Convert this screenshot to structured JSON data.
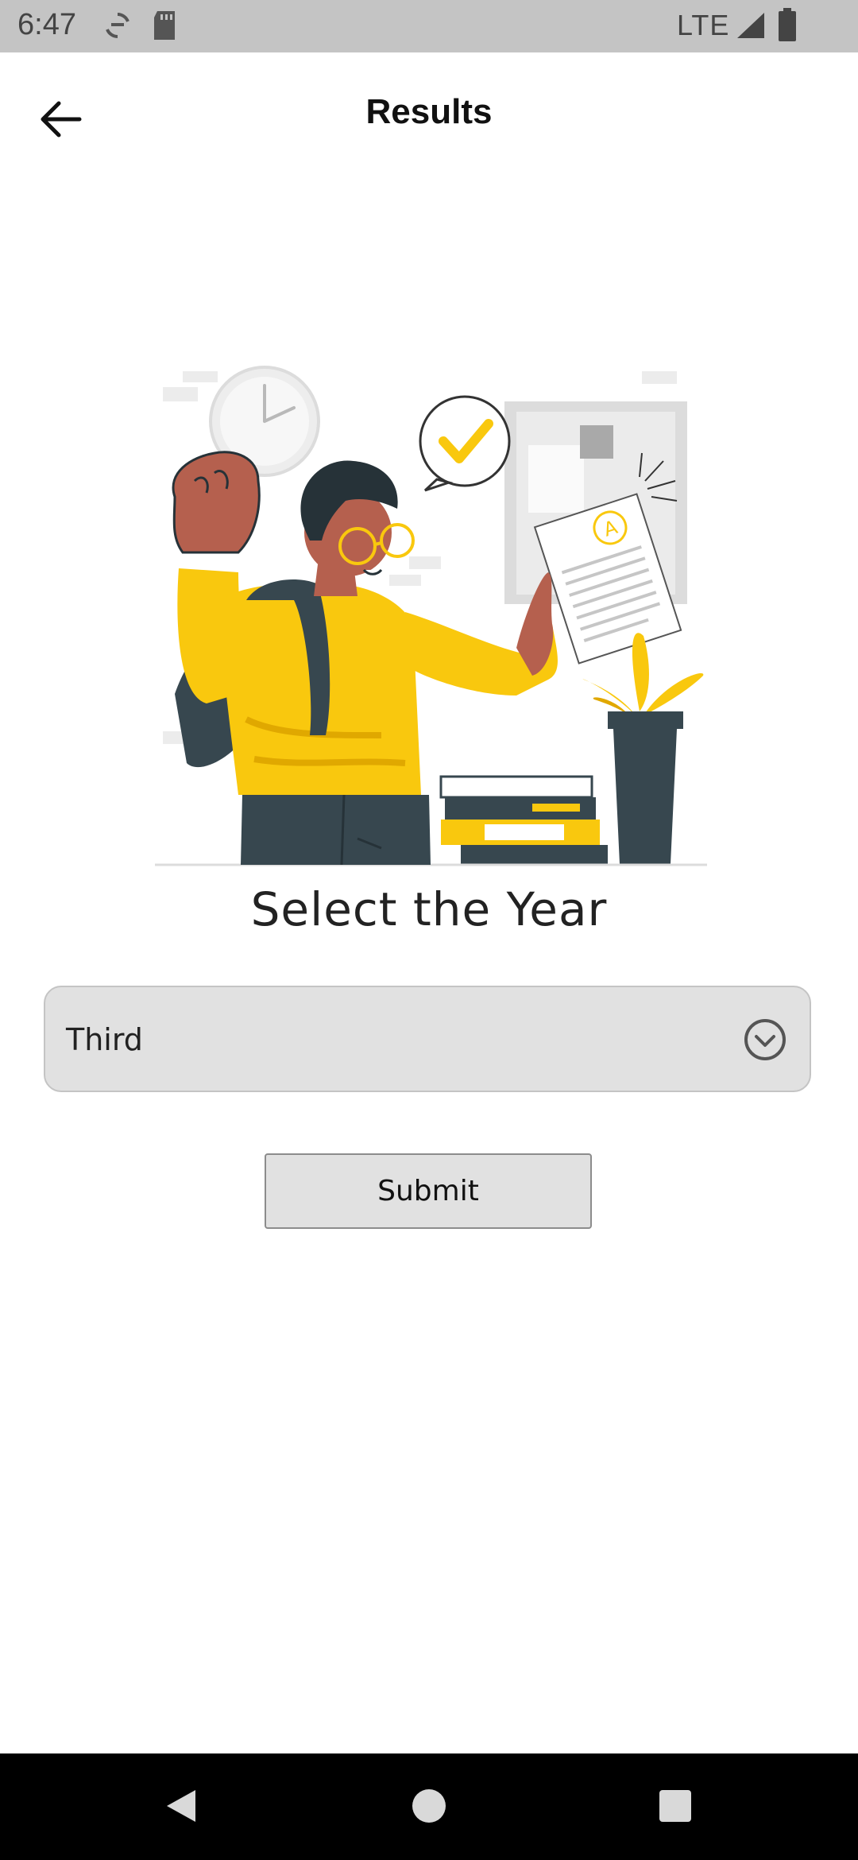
{
  "status_bar": {
    "time": "6:47",
    "network": "LTE",
    "icons": [
      "sync-icon",
      "sd-card-icon",
      "signal-icon",
      "battery-icon"
    ]
  },
  "app_bar": {
    "title": "Results",
    "back_icon": "arrow-left-icon"
  },
  "main": {
    "heading": "Select the Year",
    "year_dropdown": {
      "selected": "Third",
      "icon": "chevron-down-circle-icon"
    },
    "submit_label": "Submit"
  },
  "colors": {
    "accent_yellow": "#f9c80e",
    "dark_teal": "#37474f",
    "skin": "#b5604e",
    "field_bg": "#e1e1e1"
  },
  "nav_bar": {
    "icons": [
      "back-triangle-icon",
      "home-circle-icon",
      "recents-square-icon"
    ]
  }
}
